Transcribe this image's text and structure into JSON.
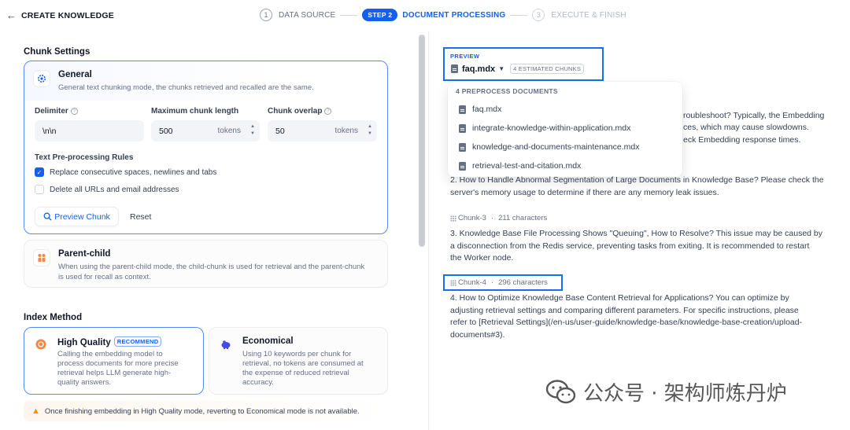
{
  "header": {
    "back_glyph": "←",
    "title": "CREATE KNOWLEDGE",
    "steps": [
      {
        "num": "1",
        "label": "DATA SOURCE"
      },
      {
        "pill": "STEP 2",
        "label": "DOCUMENT PROCESSING"
      },
      {
        "num": "3",
        "label": "EXECUTE & FINISH"
      }
    ]
  },
  "chunk_settings": {
    "title": "Chunk Settings",
    "general": {
      "title": "General",
      "desc": "General text chunking mode, the chunks retrieved and recalled are the same."
    },
    "delimiter": {
      "label": "Delimiter",
      "value": "\\n\\n"
    },
    "max_length": {
      "label": "Maximum chunk length",
      "value": "500",
      "unit": "tokens"
    },
    "overlap": {
      "label": "Chunk overlap",
      "value": "50",
      "unit": "tokens"
    },
    "rules_title": "Text Pre-processing Rules",
    "rules": [
      {
        "label": "Replace consecutive spaces, newlines and tabs",
        "checked": true
      },
      {
        "label": "Delete all URLs and email addresses",
        "checked": false
      }
    ],
    "preview_button": "Preview Chunk",
    "reset_button": "Reset",
    "parent_child": {
      "title": "Parent-child",
      "desc_line1": "When using the parent-child mode, the child-chunk is used for retrieval and the parent-chunk",
      "desc_line2": "is used for recall as context."
    }
  },
  "index_method": {
    "title": "Index Method",
    "high_quality": {
      "title": "High Quality",
      "badge": "RECOMMEND",
      "desc": [
        "Calling the embedding model to",
        "process documents for more precise",
        "retrieval helps LLM generate high-",
        "quality answers."
      ]
    },
    "economical": {
      "title": "Economical",
      "desc": [
        "Using 10 keywords per chunk for",
        "retrieval, no tokens are consumed at",
        "the expense of reduced retrieval",
        "accuracy."
      ]
    },
    "warning": "Once finishing embedding in High Quality mode, reverting to Economical mode is not available."
  },
  "preview": {
    "label": "PREVIEW",
    "file": "faq.mdx",
    "chunks_badge": "4 ESTIMATED CHUNKS",
    "dropdown": {
      "title": "4 PREPROCESS DOCUMENTS",
      "items": [
        "faq.mdx",
        "integrate-knowledge-within-application.mdx",
        "knowledge-and-documents-maintenance.mdx",
        "retrieval-test-and-citation.mdx"
      ]
    },
    "partial_lines": [
      "roubleshoot? Typically, the Embedding",
      "ces, which may cause slowdowns.",
      "eck Embedding response times."
    ],
    "chunk2_lines": [
      "2. How to Handle Abnormal Segmentation of Large Documents in Knowledge Base? Please check the",
      "server's memory usage to determine if there are any memory leak issues."
    ],
    "chunk3": {
      "name": "Chunk-3",
      "chars": "211 characters",
      "lines": [
        "3. Knowledge Base File Processing Shows \"Queuing\", How to Resolve? This issue may be caused by",
        "a disconnection from the Redis service, preventing tasks from exiting. It is recommended to restart",
        "the Worker node."
      ]
    },
    "chunk4": {
      "name": "Chunk-4",
      "chars": "296 characters",
      "lines": [
        "4. How to Optimize Knowledge Base Content Retrieval for Applications? You can optimize by",
        "adjusting retrieval settings and comparing different parameters. For specific instructions, please",
        "refer to [Retrieval Settings](/en-us/user-guide/knowledge-base/knowledge-base-creation/upload-",
        "documents#3)."
      ]
    },
    "separator": "·"
  },
  "watermark": {
    "text": "公众号 · 架构师炼丹炉"
  }
}
